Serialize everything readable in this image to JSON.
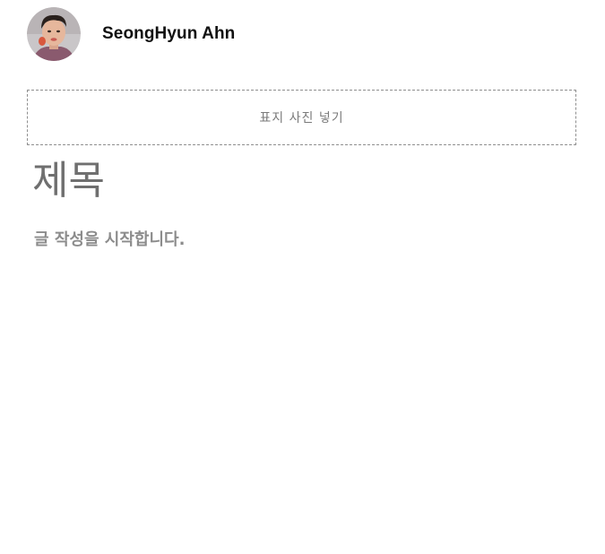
{
  "author": {
    "name": "SeongHyun Ahn",
    "avatar_icon": "user-photo"
  },
  "editor": {
    "cover_placeholder": "표지 사진 넣기",
    "title_placeholder": "제목",
    "body_placeholder": "글 작성을 시작합니다."
  },
  "colors": {
    "placeholder_text": "#6f6f6f",
    "body_placeholder_text": "#8c8c8c",
    "dashed_border": "#8f8f8f",
    "name_text": "#111111"
  }
}
